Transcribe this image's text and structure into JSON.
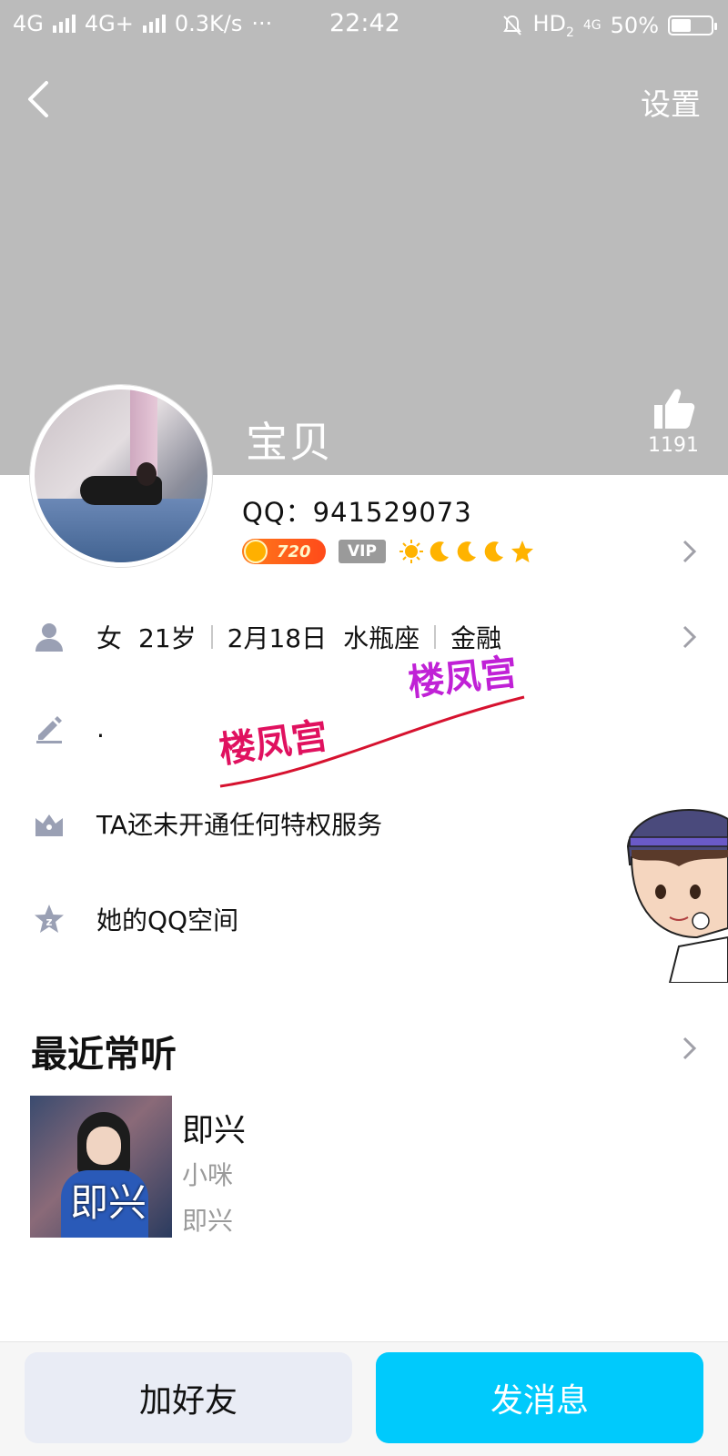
{
  "status_bar": {
    "network1": "4G",
    "network2": "4G+",
    "speed": "0.3K/s",
    "more": "···",
    "time": "22:42",
    "hd": "HD",
    "hd_sub": "2",
    "net3": "4G",
    "battery": "50%",
    "battery_fraction": 0.5
  },
  "nav": {
    "back_icon": "chevron-left-icon",
    "settings_label": "设置"
  },
  "profile": {
    "nickname": "宝贝",
    "like_count": "1191",
    "qq_label": "QQ：941529073",
    "coin_value": "720",
    "vip_label": "VIP"
  },
  "info": {
    "gender": "女",
    "age": "21岁",
    "birthday": "2月18日",
    "zodiac": "水瓶座",
    "occupation": "金融",
    "signature": ".",
    "privilege": "TA还未开通任何特权服务",
    "qzone": "她的QQ空间"
  },
  "watermark": {
    "text1": "楼凤宫",
    "text2": "楼凤宫"
  },
  "recent": {
    "title": "最近常听",
    "song_title": "即兴",
    "artist": "小咪",
    "album": "即兴",
    "cover_title": "即兴"
  },
  "actions": {
    "add_friend": "加好友",
    "send_message": "发消息"
  },
  "colors": {
    "header_bg": "#bbbbbb",
    "accent_button": "#00cafc",
    "secondary_button": "#e9ecf5",
    "muted_text": "#9a9a9a"
  }
}
